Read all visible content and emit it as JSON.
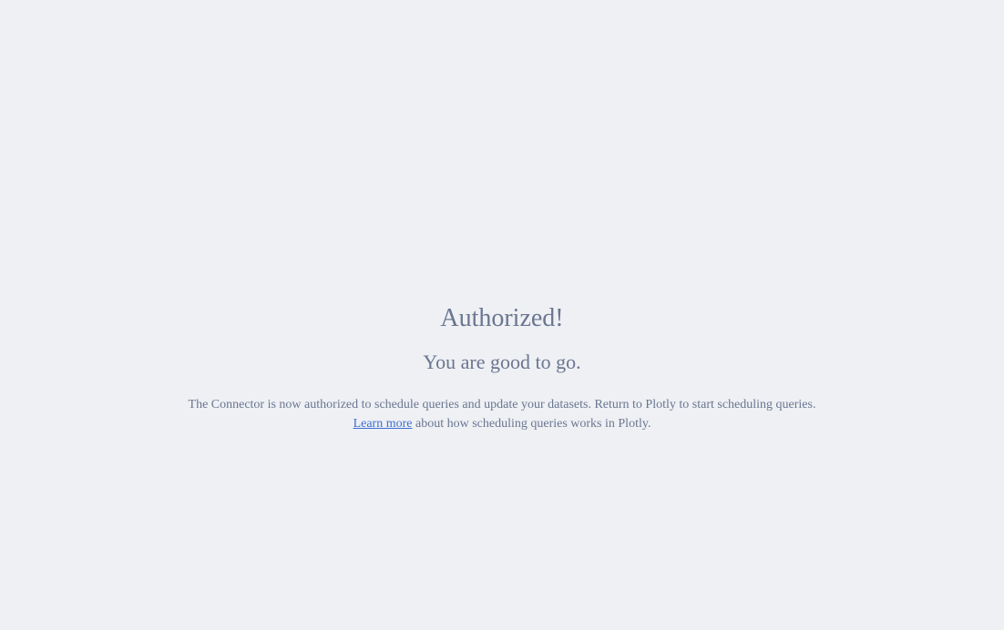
{
  "heading": "Authorized!",
  "subheading": "You are good to go.",
  "message_line1": "The Connector is now authorized to schedule queries and update your datasets. Return to Plotly to start scheduling queries.",
  "learn_more_link": "Learn more",
  "message_line2_rest": " about how scheduling queries works in Plotly.",
  "colors": {
    "background": "#eef0f4",
    "text": "#6a7690",
    "link": "#3d6fd1"
  }
}
